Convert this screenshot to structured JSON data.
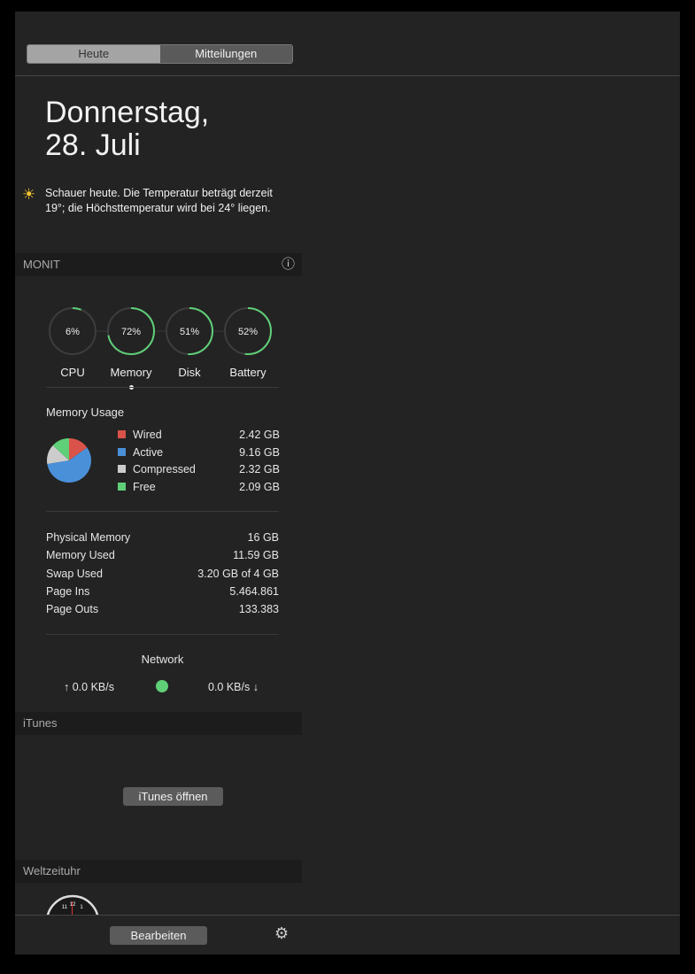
{
  "tabs": [
    {
      "label": "Heute",
      "active": true
    },
    {
      "label": "Mitteilungen",
      "active": false
    }
  ],
  "date": {
    "line1": "Donnerstag,",
    "line2": "28. Juli"
  },
  "weather": {
    "icon": "sun-icon",
    "text": "Schauer heute. Die Temperatur beträgt derzeit 19°; die Höchsttemperatur wird bei 24° liegen."
  },
  "monit": {
    "title": "MONIT",
    "info_icon": "info-icon",
    "gauges": [
      {
        "label": "CPU",
        "value_text": "6%",
        "percent": 6
      },
      {
        "label": "Memory",
        "value_text": "72%",
        "percent": 72
      },
      {
        "label": "Disk",
        "value_text": "51%",
        "percent": 51
      },
      {
        "label": "Battery",
        "value_text": "52%",
        "percent": 52
      }
    ],
    "gauge_color": "#5fcf78",
    "memory_title": "Memory Usage",
    "memory": [
      {
        "label": "Wired",
        "value": "2.42 GB",
        "gb": 2.42,
        "color": "#d9534a"
      },
      {
        "label": "Active",
        "value": "9.16 GB",
        "gb": 9.16,
        "color": "#4a90d9"
      },
      {
        "label": "Compressed",
        "value": "2.32 GB",
        "gb": 2.32,
        "color": "#cccccc"
      },
      {
        "label": "Free",
        "value": "2.09 GB",
        "gb": 2.09,
        "color": "#5fcf78"
      }
    ],
    "stats": [
      {
        "label": "Physical Memory",
        "value": "16 GB"
      },
      {
        "label": "Memory Used",
        "value": "11.59 GB"
      },
      {
        "label": "Swap Used",
        "value": "3.20 GB of 4 GB"
      },
      {
        "label": "Page Ins",
        "value": "5.464.861"
      },
      {
        "label": "Page Outs",
        "value": "133.383"
      }
    ],
    "network": {
      "title": "Network",
      "up": "↑ 0.0 KB/s",
      "down": "0.0 KB/s ↓",
      "status_color": "#5fcf78"
    }
  },
  "itunes": {
    "title": "iTunes",
    "button": "iTunes öffnen"
  },
  "worldclock": {
    "title": "Weltzeituhr"
  },
  "footer": {
    "edit": "Bearbeiten",
    "settings_icon": "gear-icon"
  }
}
